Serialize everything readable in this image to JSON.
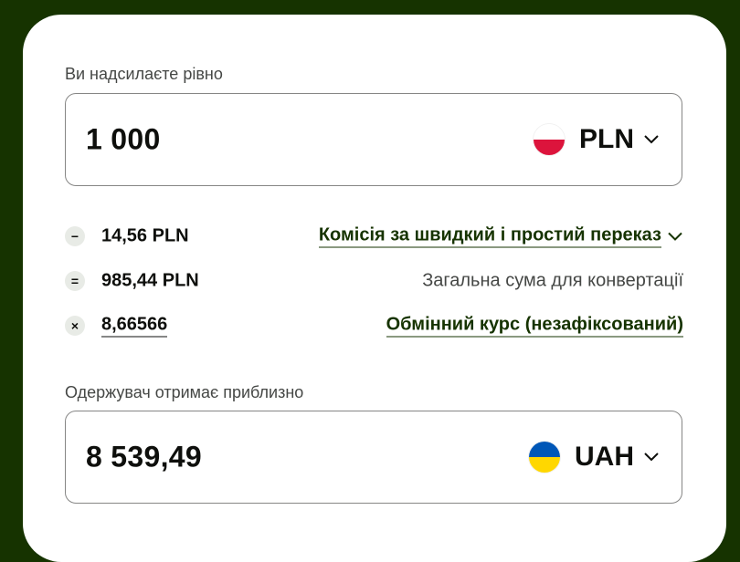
{
  "send": {
    "label": "Ви надсилаєте рівно",
    "amount": "1 000",
    "currency": "PLN",
    "flag": "poland-flag",
    "flag_colors": [
      "#ffffff",
      "#dc143c"
    ]
  },
  "breakdown": [
    {
      "operator": "−",
      "amount": "14,56 PLN",
      "text": "Комісія за швидкий і простий переказ",
      "is_link": true,
      "has_dropdown": true
    },
    {
      "operator": "=",
      "amount": "985,44 PLN",
      "text": "Загальна сума для конвертації",
      "is_link": false,
      "has_dropdown": false
    },
    {
      "operator": "×",
      "amount": "8,66566",
      "text": "Обмінний курс (незафіксований)",
      "is_link": true,
      "has_dropdown": false
    }
  ],
  "receive": {
    "label": "Одержувач отримає приблизно",
    "amount": "8 539,49",
    "currency": "UAH",
    "flag": "ukraine-flag",
    "flag_colors": [
      "#0057b7",
      "#ffd700"
    ]
  },
  "colors": {
    "background": "#163300",
    "card": "#ffffff",
    "link": "#163300",
    "muted_text": "#454745",
    "border": "#868685"
  }
}
